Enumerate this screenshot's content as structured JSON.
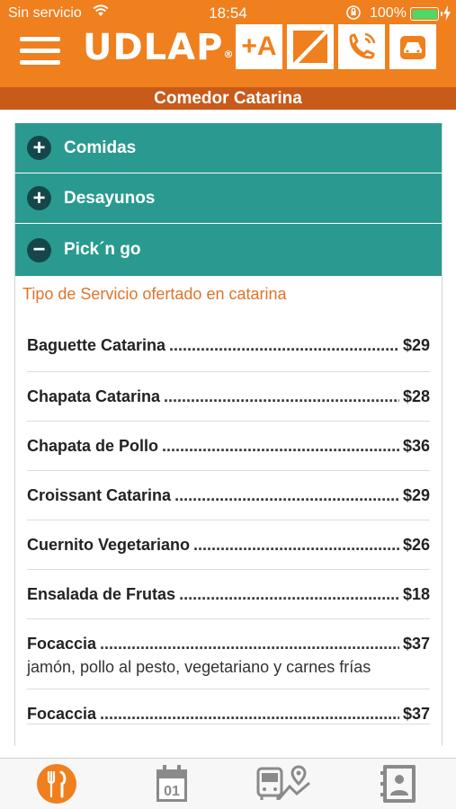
{
  "status_bar": {
    "carrier": "Sin servicio",
    "time": "18:54",
    "battery": "100%",
    "icons": [
      "wifi-icon",
      "rotation-lock-icon",
      "battery-icon",
      "charging-bolt-icon"
    ]
  },
  "header": {
    "logo": "UDLAP",
    "logo_mark": "®",
    "buttons": [
      {
        "icon": "plus-a-icon",
        "label": "+A"
      },
      {
        "icon": "flag-icon"
      },
      {
        "icon": "phone-icon"
      },
      {
        "icon": "car-icon"
      }
    ],
    "menu_icon": "hamburger-icon"
  },
  "page_title": "Comedor Catarina",
  "accordion": [
    {
      "label": "Comidas",
      "state": "collapsed",
      "icon_symbol": "+"
    },
    {
      "label": "Desayunos",
      "state": "collapsed",
      "icon_symbol": "+"
    },
    {
      "label": "Pick´n go",
      "state": "expanded",
      "icon_symbol": "−"
    }
  ],
  "section_label": "Tipo de Servicio ofertado en catarina",
  "items": [
    {
      "name": "Baguette Catarina",
      "price": "$29"
    },
    {
      "name": "Chapata Catarina",
      "price": "$28"
    },
    {
      "name": "Chapata de Pollo",
      "price": "$36"
    },
    {
      "name": "Croissant Catarina",
      "price": "$29"
    },
    {
      "name": "Cuernito Vegetariano",
      "price": "$26"
    },
    {
      "name": "Ensalada de Frutas",
      "price": "$18"
    },
    {
      "name": "Focaccia",
      "price": "$37",
      "description": "jamón, pollo al pesto, vegetariano y carnes frías"
    },
    {
      "name": "Focaccia",
      "price": "$37"
    }
  ],
  "tab_bar": [
    {
      "icon": "fork-knife-icon",
      "active": true
    },
    {
      "icon": "calendar-icon",
      "label": "01",
      "active": false
    },
    {
      "icon": "bus-map-icon",
      "active": false
    },
    {
      "icon": "contacts-book-icon",
      "active": false
    }
  ],
  "colors": {
    "brand_orange": "#f07f1e",
    "title_bar": "#c85a1a",
    "accordion_teal": "#2a9a90",
    "accordion_circle": "#15474a",
    "section_text": "#e0742a",
    "tab_active": "#f07f1e",
    "tab_inactive": "#8a8a8a"
  }
}
